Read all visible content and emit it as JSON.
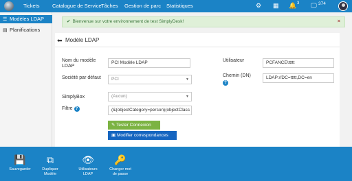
{
  "nav": {
    "items": [
      "Tickets",
      "Catalogue de Service",
      "Tâches",
      "Gestion de parc",
      "Statistiques"
    ],
    "notification_count": "3",
    "monitor_count": "374"
  },
  "sidebar": {
    "items": [
      {
        "label": "Modèles LDAP",
        "active": true
      },
      {
        "label": "Planifications",
        "active": false
      }
    ]
  },
  "alert": {
    "message": "Bienvenue sur votre environnement de test SimplyDesk!",
    "close": "×"
  },
  "panel": {
    "title": "Modèle LDAP",
    "form": {
      "model_name_label": "Nom du modèle LDAP",
      "model_name_value": "PCI Modèle LDAP",
      "company_label": "Société par défaut",
      "company_value": "PCI",
      "simplybox_label": "SimplyBox",
      "simplybox_value": "(Aucun)",
      "filter_label": "Filtre",
      "filter_value": "(&(objectCategory=person)(objectClass",
      "user_label": "Utilisateur",
      "user_value": "PCFANCE\\ttttt",
      "path_label": "Chemin (DN)",
      "path_value": "LDAP://DC=ttttt,DC=en"
    },
    "buttons": {
      "test": "Tester Connexion",
      "mapping": "Modifier correspondances"
    }
  },
  "toolbar": [
    {
      "label": "Sauvegarder",
      "icon": "save-icon"
    },
    {
      "label": "Dupliquer\nModèle",
      "icon": "duplicate-icon"
    },
    {
      "label": "Utilisateurs\nLDAP",
      "icon": "eye-icon"
    },
    {
      "label": "Changer mot\nde passe",
      "icon": "key-icon"
    }
  ]
}
